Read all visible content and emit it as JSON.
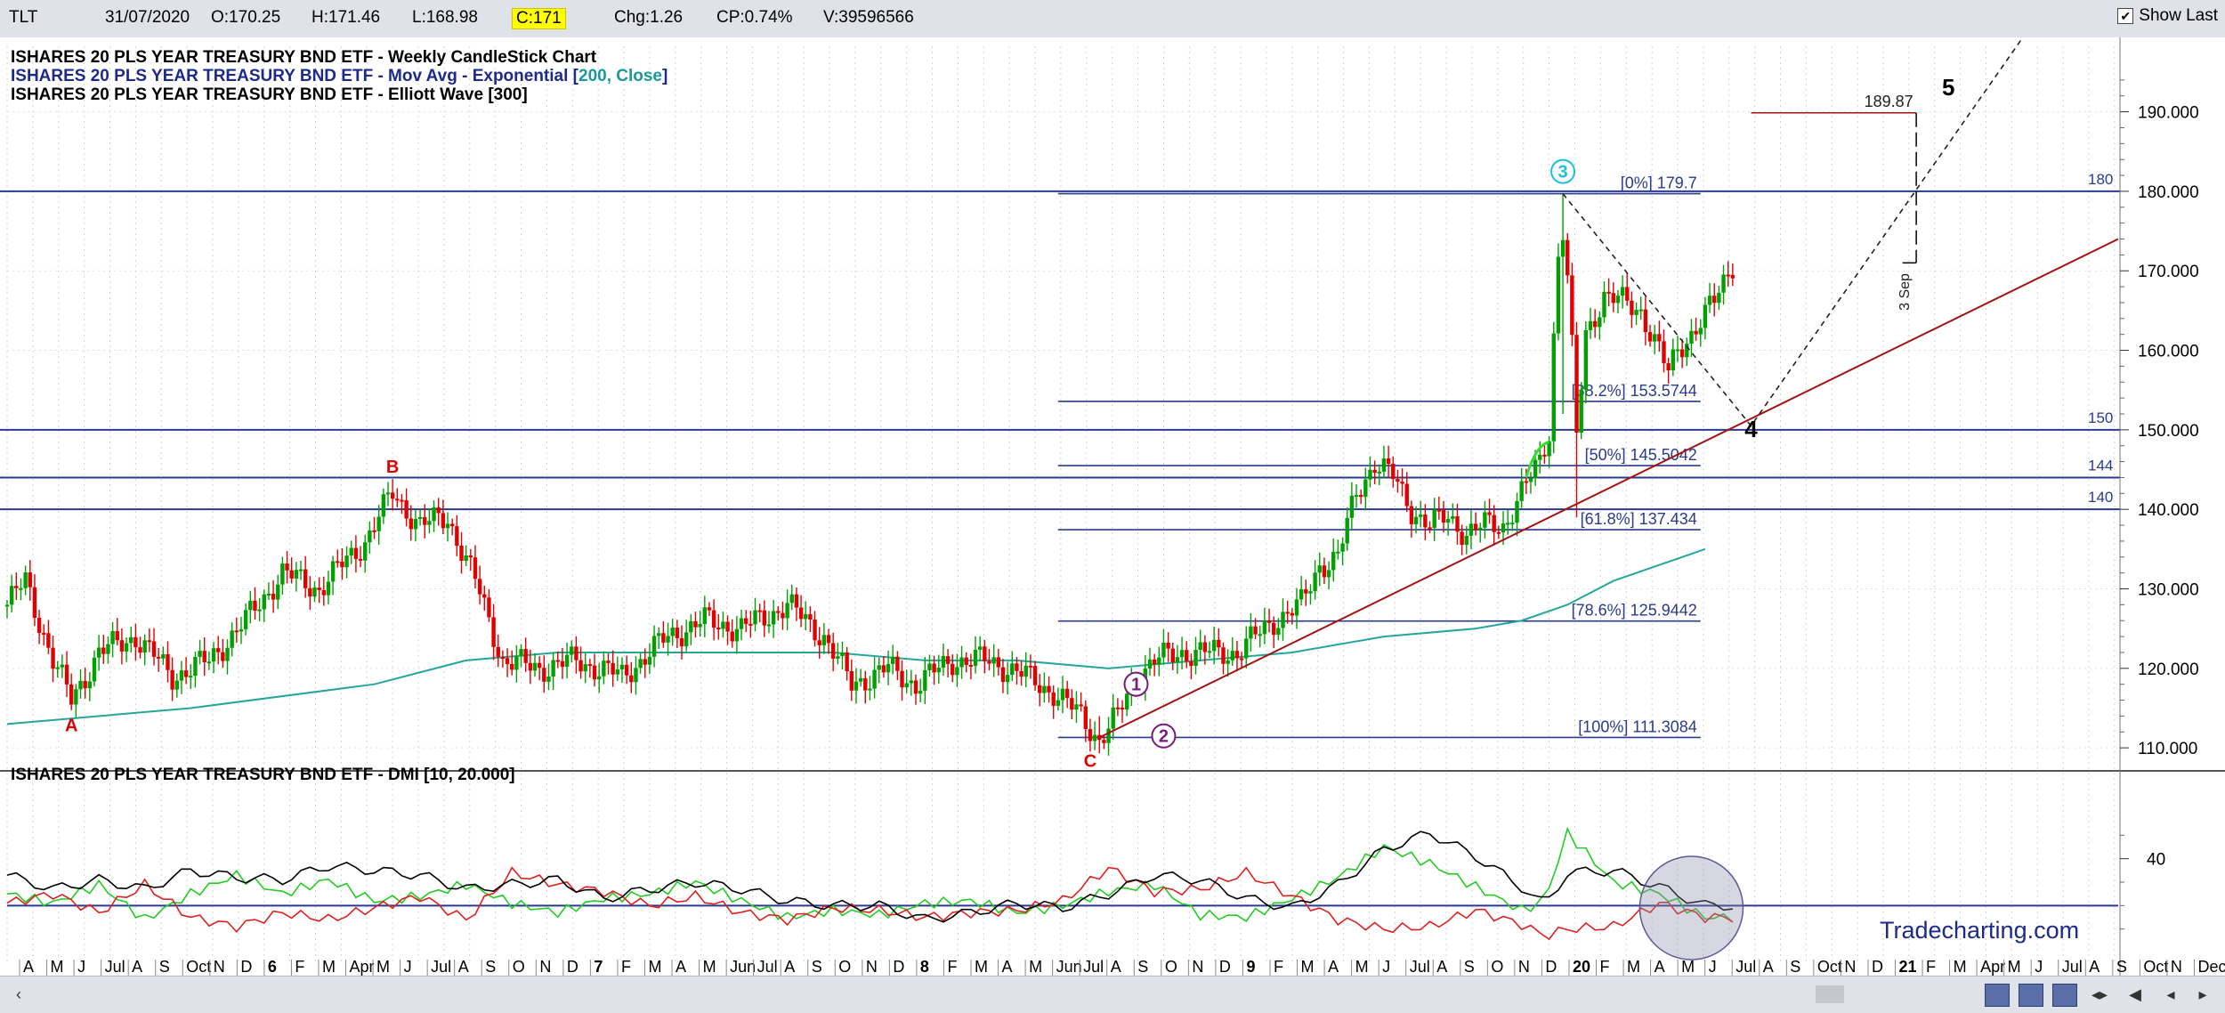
{
  "topbar": {
    "symbol": "TLT",
    "date": "31/07/2020",
    "open": "O:170.25",
    "high": "H:171.46",
    "low": "L:168.98",
    "close": "C:171",
    "change": "Chg:1.26",
    "change_pct": "CP:0.74%",
    "volume": "V:39596566",
    "show_last_label": "Show Last",
    "show_last_checked": true
  },
  "legend": {
    "line1": "ISHARES 20 PLS YEAR TREASURY BND ETF - Weekly CandleStick Chart",
    "line2_prefix": "ISHARES 20 PLS YEAR TREASURY BND ETF - Mov Avg - Exponential [",
    "line2_params": "200, Close",
    "line2_suffix": "]",
    "line3": "ISHARES 20 PLS YEAR TREASURY BND ETF - Elliott Wave [300]",
    "dmi": "ISHARES 20 PLS YEAR TREASURY BND ETF - DMI [10, 20.000]"
  },
  "watermark": "Tradecharting.com",
  "colors": {
    "up": "#00a000",
    "down": "#e00000",
    "ema": "#26a69a",
    "level": "#2a3a8c",
    "trend": "#a31515"
  },
  "chart_data": {
    "type": "candlestick",
    "price_ylim": [
      108,
      196
    ],
    "price_ticks": [
      "110.000",
      "120.000",
      "130.000",
      "140.000",
      "150.000",
      "160.000",
      "170.000",
      "180.000",
      "190.000"
    ],
    "x_ticks": [
      "A",
      "M",
      "J",
      "Jul",
      "A",
      "S",
      "Oct",
      "N",
      "D",
      "6",
      "F",
      "M",
      "Apr",
      "M",
      "J",
      "Jul",
      "A",
      "S",
      "O",
      "N",
      "D",
      "7",
      "F",
      "M",
      "A",
      "M",
      "Jun",
      "Jul",
      "A",
      "S",
      "O",
      "N",
      "D",
      "8",
      "F",
      "M",
      "A",
      "M",
      "Jun",
      "Jul",
      "A",
      "S",
      "O",
      "N",
      "D",
      "9",
      "F",
      "M",
      "A",
      "M",
      "J",
      "Jul",
      "A",
      "S",
      "O",
      "N",
      "D",
      "20",
      "F",
      "M",
      "A",
      "M",
      "J",
      "Jul",
      "A",
      "S",
      "Oct",
      "N",
      "D",
      "21",
      "F",
      "M",
      "Apr",
      "M",
      "J",
      "Jul",
      "A",
      "S",
      "Oct",
      "N",
      "Dec"
    ],
    "anchors": [
      [
        0,
        128
      ],
      [
        4,
        131
      ],
      [
        10,
        121
      ],
      [
        14,
        116
      ],
      [
        20,
        122
      ],
      [
        28,
        124
      ],
      [
        36,
        119
      ],
      [
        44,
        121
      ],
      [
        52,
        126
      ],
      [
        60,
        132
      ],
      [
        68,
        130
      ],
      [
        78,
        136
      ],
      [
        84,
        142
      ],
      [
        90,
        138
      ],
      [
        96,
        139
      ],
      [
        102,
        131
      ],
      [
        108,
        121
      ],
      [
        116,
        120
      ],
      [
        124,
        121
      ],
      [
        134,
        119
      ],
      [
        144,
        124
      ],
      [
        152,
        126
      ],
      [
        160,
        125
      ],
      [
        170,
        128
      ],
      [
        178,
        124
      ],
      [
        184,
        118
      ],
      [
        192,
        120
      ],
      [
        198,
        118
      ],
      [
        206,
        121
      ],
      [
        214,
        121
      ],
      [
        222,
        119
      ],
      [
        228,
        117
      ],
      [
        234,
        114
      ],
      [
        238,
        111
      ],
      [
        242,
        114
      ],
      [
        246,
        119
      ],
      [
        250,
        121
      ],
      [
        256,
        122
      ],
      [
        262,
        122
      ],
      [
        268,
        122
      ],
      [
        276,
        126
      ],
      [
        282,
        128
      ],
      [
        286,
        133
      ],
      [
        290,
        134
      ],
      [
        294,
        142
      ],
      [
        298,
        146
      ],
      [
        302,
        144
      ],
      [
        306,
        140
      ],
      [
        310,
        138
      ],
      [
        314,
        139
      ],
      [
        318,
        137
      ],
      [
        322,
        138
      ],
      [
        326,
        138
      ],
      [
        330,
        142
      ],
      [
        334,
        146
      ],
      [
        336,
        150
      ],
      [
        337,
        162
      ],
      [
        338,
        172
      ],
      [
        339,
        175
      ],
      [
        340,
        169
      ],
      [
        341,
        160
      ],
      [
        342,
        149
      ],
      [
        344,
        162
      ],
      [
        348,
        167
      ],
      [
        352,
        166
      ],
      [
        356,
        165
      ],
      [
        360,
        160
      ],
      [
        362,
        157
      ],
      [
        364,
        160
      ],
      [
        368,
        163
      ],
      [
        372,
        166
      ],
      [
        376,
        171
      ]
    ],
    "extremes": [
      {
        "index": 339,
        "high": 179.7,
        "low": 152
      },
      {
        "index": 342,
        "high": 158,
        "low": 139
      },
      {
        "index": 238,
        "high": 114,
        "low": 110.5
      }
    ],
    "ema_200": [
      [
        0,
        113
      ],
      [
        40,
        115
      ],
      [
        80,
        118
      ],
      [
        100,
        121
      ],
      [
        120,
        122
      ],
      [
        150,
        122
      ],
      [
        180,
        122
      ],
      [
        200,
        121
      ],
      [
        220,
        121
      ],
      [
        240,
        120
      ],
      [
        260,
        121
      ],
      [
        280,
        122
      ],
      [
        300,
        124
      ],
      [
        320,
        125
      ],
      [
        330,
        126
      ],
      [
        340,
        128
      ],
      [
        350,
        131
      ],
      [
        360,
        133
      ],
      [
        370,
        135
      ]
    ],
    "levels": [
      {
        "label": "[0%] 179.7",
        "value": 179.7
      },
      {
        "label": "[38.2%] 153.5744",
        "value": 153.5744
      },
      {
        "label": "[50%] 145.5042",
        "value": 145.5042
      },
      {
        "label": "[61.8%] 137.434",
        "value": 137.434
      },
      {
        "label": "[78.6%] 125.9442",
        "value": 125.9442
      },
      {
        "label": "[100%] 111.3084",
        "value": 111.3084
      }
    ],
    "hlines": [
      {
        "label": "180",
        "value": 180
      },
      {
        "label": "150",
        "value": 150
      },
      {
        "label": "144",
        "value": 144
      },
      {
        "label": "140",
        "value": 140
      }
    ],
    "target": {
      "label": "189.87",
      "value": 189.87
    },
    "vertical_note": "3 Sep",
    "trendline": [
      [
        238,
        111.3
      ],
      [
        460,
        174
      ]
    ],
    "projection": [
      [
        339,
        179.7
      ],
      [
        380,
        150.5
      ],
      [
        440,
        200
      ]
    ],
    "waves": [
      {
        "label": "A",
        "index": 14,
        "value": 113,
        "color": "#e00000"
      },
      {
        "label": "B",
        "index": 84,
        "value": 145.5,
        "color": "#e00000"
      },
      {
        "label": "C",
        "index": 236,
        "value": 108.5,
        "color": "#e00000"
      },
      {
        "label": "1",
        "index": 246,
        "value": 118,
        "color": "#7a1a7a",
        "circle": true
      },
      {
        "label": "2",
        "index": 252,
        "value": 111.5,
        "color": "#7a1a7a",
        "circle": true
      },
      {
        "label": "3",
        "index": 339,
        "value": 182.5,
        "color": "#19c2d4",
        "circle": true
      },
      {
        "label": "4",
        "index": 380,
        "value": 150,
        "color": "#000000"
      },
      {
        "label": "5",
        "index": 423,
        "value": 193,
        "color": "#000000"
      }
    ],
    "dmi": {
      "ylim": [
        0,
        60
      ],
      "ticks": [
        "40"
      ],
      "threshold": 20,
      "adx": [
        [
          0,
          33
        ],
        [
          10,
          27
        ],
        [
          20,
          31
        ],
        [
          30,
          27
        ],
        [
          40,
          35
        ],
        [
          50,
          32
        ],
        [
          60,
          31
        ],
        [
          70,
          37
        ],
        [
          80,
          35
        ],
        [
          90,
          33
        ],
        [
          100,
          27
        ],
        [
          110,
          29
        ],
        [
          120,
          31
        ],
        [
          130,
          23
        ],
        [
          140,
          27
        ],
        [
          150,
          30
        ],
        [
          160,
          27
        ],
        [
          170,
          22
        ],
        [
          180,
          20
        ],
        [
          190,
          20
        ],
        [
          200,
          14
        ],
        [
          210,
          17
        ],
        [
          220,
          21
        ],
        [
          230,
          19
        ],
        [
          240,
          25
        ],
        [
          250,
          33
        ],
        [
          260,
          31
        ],
        [
          270,
          23
        ],
        [
          280,
          19
        ],
        [
          290,
          29
        ],
        [
          300,
          44
        ],
        [
          310,
          51
        ],
        [
          320,
          41
        ],
        [
          330,
          28
        ],
        [
          335,
          20
        ],
        [
          340,
          34
        ],
        [
          350,
          35
        ],
        [
          360,
          28
        ],
        [
          370,
          20
        ]
      ],
      "plus_di": [
        [
          0,
          25
        ],
        [
          10,
          21
        ],
        [
          20,
          29
        ],
        [
          30,
          14
        ],
        [
          40,
          25
        ],
        [
          50,
          33
        ],
        [
          60,
          25
        ],
        [
          70,
          31
        ],
        [
          80,
          22
        ],
        [
          90,
          24
        ],
        [
          100,
          29
        ],
        [
          110,
          21
        ],
        [
          120,
          17
        ],
        [
          130,
          23
        ],
        [
          140,
          25
        ],
        [
          150,
          30
        ],
        [
          160,
          22
        ],
        [
          170,
          15
        ],
        [
          180,
          18
        ],
        [
          190,
          16
        ],
        [
          200,
          21
        ],
        [
          210,
          22
        ],
        [
          220,
          17
        ],
        [
          230,
          20
        ],
        [
          240,
          26
        ],
        [
          250,
          29
        ],
        [
          260,
          16
        ],
        [
          270,
          15
        ],
        [
          280,
          23
        ],
        [
          290,
          32
        ],
        [
          300,
          45
        ],
        [
          310,
          38
        ],
        [
          320,
          28
        ],
        [
          330,
          18
        ],
        [
          335,
          22
        ],
        [
          340,
          51
        ],
        [
          350,
          30
        ],
        [
          360,
          25
        ],
        [
          370,
          15
        ]
      ],
      "minus_di": [
        [
          0,
          21
        ],
        [
          10,
          25
        ],
        [
          20,
          17
        ],
        [
          30,
          29
        ],
        [
          40,
          15
        ],
        [
          50,
          11
        ],
        [
          60,
          17
        ],
        [
          70,
          14
        ],
        [
          80,
          19
        ],
        [
          90,
          24
        ],
        [
          100,
          14
        ],
        [
          110,
          34
        ],
        [
          120,
          29
        ],
        [
          130,
          26
        ],
        [
          140,
          20
        ],
        [
          150,
          24
        ],
        [
          160,
          17
        ],
        [
          170,
          14
        ],
        [
          180,
          19
        ],
        [
          190,
          18
        ],
        [
          200,
          15
        ],
        [
          210,
          17
        ],
        [
          220,
          18
        ],
        [
          230,
          22
        ],
        [
          240,
          36
        ],
        [
          250,
          26
        ],
        [
          260,
          27
        ],
        [
          270,
          34
        ],
        [
          280,
          24
        ],
        [
          290,
          14
        ],
        [
          300,
          10
        ],
        [
          310,
          11
        ],
        [
          320,
          18
        ],
        [
          330,
          12
        ],
        [
          335,
          7
        ],
        [
          340,
          10
        ],
        [
          350,
          11
        ],
        [
          360,
          21
        ],
        [
          370,
          15
        ]
      ]
    }
  }
}
